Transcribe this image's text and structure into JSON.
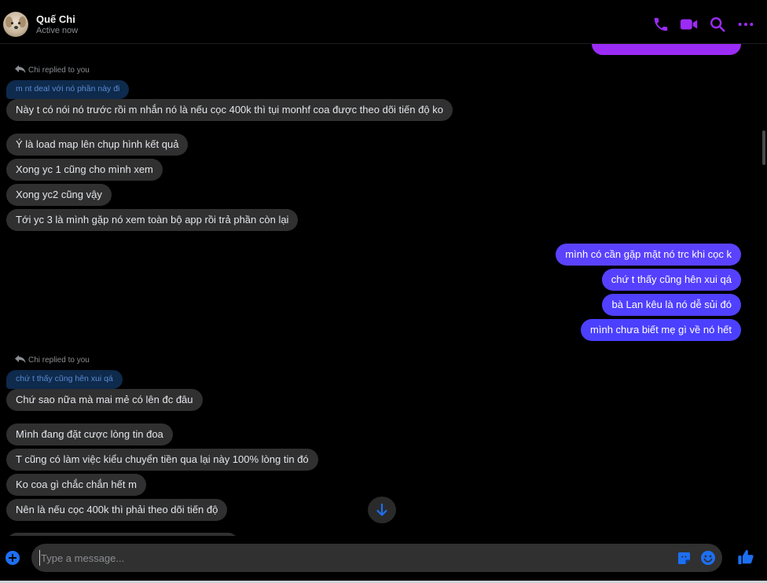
{
  "header": {
    "name": "Quế Chi",
    "status": "Active now",
    "icons": [
      "phone-icon",
      "video-camera-icon",
      "search-icon",
      "more-options-icon"
    ],
    "accent_color": "#9b2cf5"
  },
  "messages": [
    {
      "type": "reply_label",
      "text": "Chi replied to you"
    },
    {
      "type": "quoted",
      "text": "m nt deal với nó phần này đi"
    },
    {
      "type": "incoming",
      "text": "Này t có nói nó trước rồi m nhắn nó là nếu cọc 400k thì tụi monhf coa được theo dõi tiến độ ko"
    },
    {
      "type": "incoming",
      "text": "Ý là load map lên chụp hình kết quả"
    },
    {
      "type": "incoming",
      "text": "Xong yc 1 cũng cho mình xem"
    },
    {
      "type": "incoming",
      "text": "Xong yc2 cũng vậy"
    },
    {
      "type": "incoming",
      "text": "Tới yc 3 là mình gặp nó xem toàn bộ app rồi trả phần còn lại"
    },
    {
      "type": "outgoing",
      "text": "mình có cần gặp mặt nó trc khi cọc k"
    },
    {
      "type": "outgoing",
      "text": "chứ t thấy cũng hên xui qá"
    },
    {
      "type": "outgoing",
      "text": "bà Lan kêu là nó dễ sủi đó"
    },
    {
      "type": "outgoing",
      "text": "mình chưa biết mẹ gì về nó hết"
    },
    {
      "type": "reply_label",
      "text": "Chi replied to you"
    },
    {
      "type": "quoted",
      "text": "chứ t thấy cũng hên xui qá"
    },
    {
      "type": "incoming",
      "text": "Chứ sao nữa mà mai mẻ có lên đc đâu"
    },
    {
      "type": "incoming",
      "text": "Mình đang đặt cược lòng tin đoa"
    },
    {
      "type": "incoming",
      "text": "T cũng có làm việc kiểu chuyển tiền qua lại này 100% lòng tin đó"
    },
    {
      "type": "incoming",
      "text": "Ko coa gì chắc chắn hết m"
    },
    {
      "type": "incoming",
      "text": "Nên là nếu cọc 400k thì phải theo dõi tiến độ"
    }
  ],
  "composer": {
    "placeholder": "Type a message...",
    "value": "",
    "icons": [
      "add-icon",
      "sticker-icon",
      "emoji-icon",
      "thumbs-up-icon"
    ],
    "accent_color": "#1d6ff2"
  },
  "colors": {
    "incoming_bubble": "#303030",
    "outgoing_bubble": "#6140ff",
    "quoted_bubble": "#0e2a4c"
  }
}
